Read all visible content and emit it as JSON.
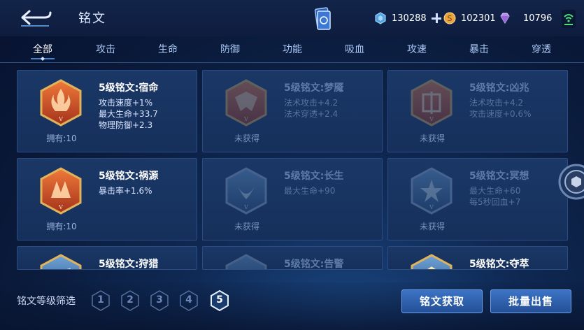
{
  "header": {
    "title": "铭文",
    "coupons": "130288",
    "gold": "102301",
    "diamonds": "10796"
  },
  "tabs": [
    {
      "label": "全部",
      "active": true
    },
    {
      "label": "攻击"
    },
    {
      "label": "生命"
    },
    {
      "label": "防御"
    },
    {
      "label": "功能"
    },
    {
      "label": "吸血"
    },
    {
      "label": "攻速"
    },
    {
      "label": "暴击"
    },
    {
      "label": "穿透"
    }
  ],
  "cards": [
    {
      "name": "5级铭文:宿命",
      "stats": [
        "攻击速度+1%",
        "最大生命+33.7",
        "物理防御+2.3"
      ],
      "status": "拥有:10",
      "color": "red",
      "locked": false
    },
    {
      "name": "5级铭文:梦魇",
      "stats": [
        "法术攻击+4.2",
        "法术穿透+2.4"
      ],
      "status": "未获得",
      "color": "red",
      "locked": true
    },
    {
      "name": "5级铭文:凶兆",
      "stats": [
        "法术攻击+4.2",
        "攻击速度+0.6%"
      ],
      "status": "未获得",
      "color": "red",
      "locked": true
    },
    {
      "name": "5级铭文:祸源",
      "stats": [
        "暴击率+1.6%"
      ],
      "status": "拥有:10",
      "color": "red",
      "locked": false
    },
    {
      "name": "5级铭文:长生",
      "stats": [
        "最大生命+90"
      ],
      "status": "未获得",
      "color": "blue",
      "locked": true
    },
    {
      "name": "5级铭文:冥想",
      "stats": [
        "最大生命+60",
        "每5秒回血+7"
      ],
      "status": "未获得",
      "color": "blue",
      "locked": true
    },
    {
      "name": "5级铭文:狩猎",
      "stats": [],
      "status": "",
      "color": "blue",
      "locked": false
    },
    {
      "name": "5级铭文:告警",
      "stats": [],
      "status": "",
      "color": "blue",
      "locked": true
    },
    {
      "name": "5级铭文:夺萃",
      "stats": [],
      "status": "",
      "color": "blue",
      "locked": false
    }
  ],
  "footer": {
    "filter_label": "铭文等级筛选",
    "levels": [
      "1",
      "2",
      "3",
      "4",
      "5"
    ],
    "active_level": "5",
    "get_button": "铭文获取",
    "sell_button": "批量出售"
  },
  "colors": {
    "accent": "#3c74c6",
    "red_emblem": "#d9532a",
    "blue_emblem": "#3a6ba6",
    "gold_frame": "#e0b25a"
  }
}
